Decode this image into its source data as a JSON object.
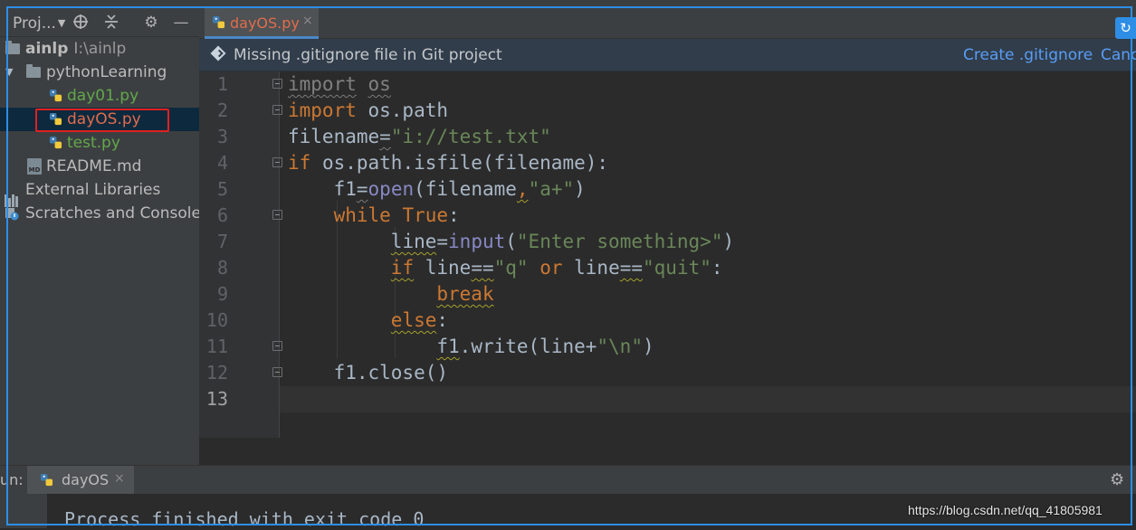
{
  "project_panel": {
    "title": "Proj...",
    "tree": [
      {
        "name": "ainlp",
        "path": "I:\\ainlp"
      },
      {
        "name": "pythonLearning"
      },
      {
        "name": "day01.py"
      },
      {
        "name": "dayOS.py"
      },
      {
        "name": "test.py"
      },
      {
        "name": "README.md"
      },
      {
        "name": "External Libraries"
      },
      {
        "name": "Scratches and Consoles"
      }
    ]
  },
  "editor": {
    "tab": {
      "label": "dayOS.py",
      "close": "×"
    },
    "banner": {
      "message": "Missing .gitignore file in Git project",
      "create_link": "Create .gitignore",
      "cancel_link": "Canc"
    },
    "line_numbers": [
      "1",
      "2",
      "3",
      "4",
      "5",
      "6",
      "7",
      "8",
      "9",
      "10",
      "11",
      "12",
      "13"
    ],
    "code_tokens": {
      "l1_kw": "import",
      "l1_mod": "os",
      "l2_kw": "import",
      "l2_mod": " os.path",
      "l3_var": "filename",
      "l3_eq": "=",
      "l3_str": "\"i://test.txt\"",
      "l4_kw": "if",
      "l4_rest": " os.path.isfile(filename):",
      "l5_var": "f1",
      "l5_eq": "=",
      "l5_fn": "open",
      "l5_args": "(filename",
      "l5_comma": ",",
      "l5_str": "\"a+\"",
      "l5_end": ")",
      "l6_kw1": "while",
      "l6_kw2": " True",
      "l6_colon": ":",
      "l7_var": "line",
      "l7_eq": "=",
      "l7_fn": "input",
      "l7_open": "(",
      "l7_str": "\"Enter something>\"",
      "l7_close": ")",
      "l8_kw": "if",
      "l8_sp": " ",
      "l8_var": "line",
      "l8_eqeq": "==",
      "l8_s1": "\"q\"",
      "l8_or": " or ",
      "l8_var2": "line",
      "l8_eqeq2": "==",
      "l8_s2": "\"quit\"",
      "l8_colon": ":",
      "l9_kw": "break",
      "l10_kw": "else",
      "l10_colon": ":",
      "l11_var": "f1",
      "l11_mid": ".write(line+",
      "l11_str": "\"\\n\"",
      "l11_end": ")",
      "l12_code": "f1.close()"
    }
  },
  "run_panel": {
    "label": "un:",
    "tab_label": "dayOS",
    "tab_close": "×",
    "console_output": "Process finished with exit code 0"
  },
  "watermark": "https://blog.csdn.net/qq_41805981",
  "colors": {
    "accent_blue": "#2e8ee6",
    "highlight_red": "#e02020",
    "keyword": "#cc7832",
    "string": "#6a8759"
  },
  "icons": [
    "search-target-icon",
    "collapse-icon",
    "gear-icon",
    "minimize-icon",
    "python-file-icon",
    "folder-icon",
    "markdown-icon",
    "library-icon",
    "scratch-icon",
    "gitignore-diamond-icon"
  ]
}
